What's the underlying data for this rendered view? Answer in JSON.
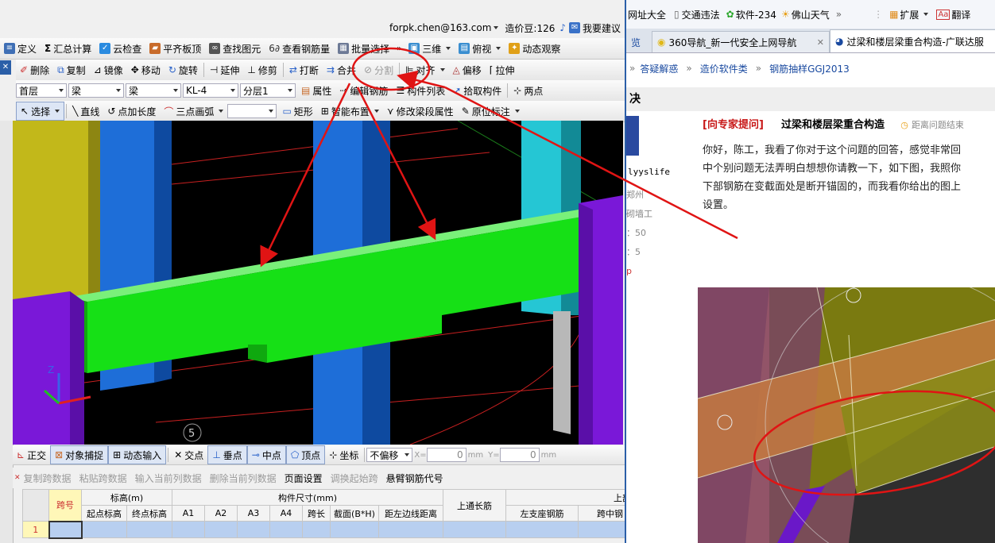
{
  "account": {
    "email": "forpk.chen@163.com",
    "beans": "造价豆:126",
    "suggest": "我要建议"
  },
  "toolbar1": {
    "items": [
      "定义",
      "汇总计算",
      "云检查",
      "平齐板顶",
      "查找图元",
      "查看钢筋量",
      "批量选择",
      "三维",
      "俯视",
      "动态观察"
    ]
  },
  "toolbar2": {
    "items": [
      "删除",
      "复制",
      "镜像",
      "移动",
      "旋转",
      "延伸",
      "修剪",
      "打断",
      "合并",
      "分割",
      "对齐",
      "偏移",
      "拉伸"
    ]
  },
  "toolbar3": {
    "floor": "首层",
    "cat1": "梁",
    "cat2": "梁",
    "comp": "KL-4",
    "layer": "分层1",
    "items": [
      "属性",
      "编辑钢筋",
      "构件列表",
      "拾取构件",
      "两点"
    ]
  },
  "toolbar4": {
    "items": [
      "选择",
      "直线",
      "点加长度",
      "三点画弧",
      "矩形",
      "智能布置",
      "修改梁段属性",
      "原位标注"
    ]
  },
  "viewport": {
    "label": "5"
  },
  "snapbar": {
    "items": [
      "正交",
      "对象捕捉",
      "动态输入",
      "交点",
      "垂点",
      "中点",
      "顶点",
      "坐标"
    ],
    "offset": "不偏移",
    "x_label": "X=",
    "x_value": "0",
    "y_label": "Y=",
    "y_value": "0",
    "unit": "mm"
  },
  "gridbar": {
    "items": [
      "复制跨数据",
      "粘贴跨数据",
      "输入当前列数据",
      "删除当前列数据",
      "页面设置",
      "调换起始跨",
      "悬臂钢筋代号"
    ]
  },
  "grid": {
    "h_span": "跨号",
    "h_elev": "标高(m)",
    "h_size": "构件尺寸(mm)",
    "h_top_long": "上通长筋",
    "h_top_bar": "上部钢",
    "sub": [
      "起点标高",
      "终点标高",
      "A1",
      "A2",
      "A3",
      "A4",
      "跨长",
      "截面(B*H)",
      "距左边线距离",
      "左支座钢筋",
      "跨中钢"
    ],
    "row1": "1"
  },
  "browser": {
    "bookmarks": [
      "网址大全",
      "交通违法",
      "软件-234",
      "佛山天气",
      "扩展",
      "翻译"
    ],
    "tabs": [
      "览",
      "360导航_新一代安全上网导航",
      "过梁和楼层梁重合构造-广联达服"
    ],
    "breadcrumb": [
      "答疑解惑",
      "造价软件类",
      "钢筋抽样GGJ2013"
    ],
    "section": "决",
    "user": "lyyslife",
    "side": [
      "郑州",
      "砌墙工",
      "：50",
      "：5",
      "p"
    ],
    "q_tag": "[向专家提问]",
    "q_title": "过梁和楼层梁重合构造",
    "q_meta": "距离问题结束",
    "q_body": [
      "你好，陈工，我看了你对于这个问题的回答，感觉非常回",
      "中个别问题无法弄明白想想你请教一下，如下图，我照你",
      "下部钢筋在变截面处是断开锚固的，而我看你给出的图上",
      "设置。"
    ]
  },
  "colors": {
    "beam": "#16e016",
    "column": "#1f6fd8",
    "purple": "#7a18d8",
    "annot": "#e01414"
  }
}
